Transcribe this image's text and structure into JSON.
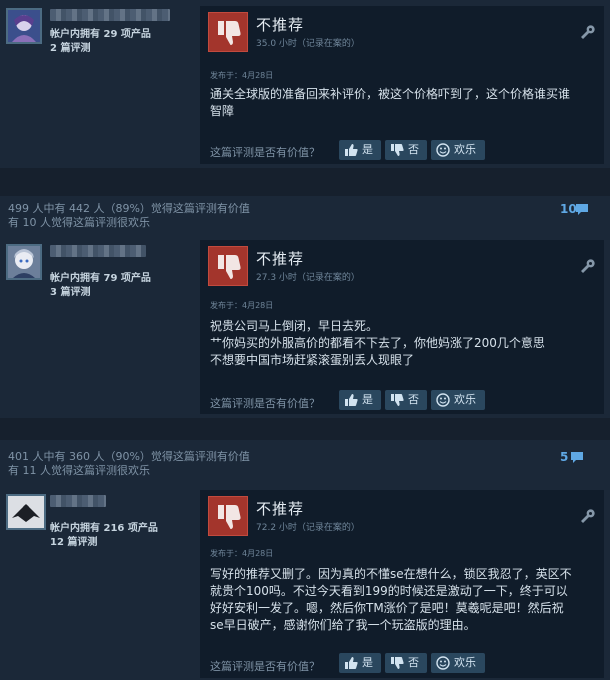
{
  "reviews": [
    {
      "owns": "帐户内拥有 29 项产品",
      "review_count": "2 篇评测",
      "recommendation": "不推荐",
      "hours": "35.0 小时（记录在案的）",
      "posted": "发布于：4月28日",
      "text_lines": [
        "通关全球版的准备回来补评价，被这个价格吓到了，这个价格谁买谁",
        "智障"
      ]
    },
    {
      "helpful_stats": [
        "499 人中有 442 人（89%）觉得这篇评测有价值",
        "有 10 人觉得这篇评测很欢乐"
      ],
      "comment_count": "10",
      "owns": "帐户内拥有 79 项产品",
      "review_count": "3 篇评测",
      "recommendation": "不推荐",
      "hours": "27.3 小时（记录在案的）",
      "posted": "发布于：4月28日",
      "text_lines": [
        "祝贵公司马上倒闭，早日去死。",
        "艹你妈买的外服高价的都看不下去了，你他妈涨了200几个意思",
        "不想要中国市场赶紧滚蛋别丢人现眼了"
      ]
    },
    {
      "helpful_stats": [
        "401 人中有 360 人（90%）觉得这篇评测有价值",
        "有 11 人觉得这篇评测很欢乐"
      ],
      "comment_count": "5",
      "owns": "帐户内拥有 216 项产品",
      "review_count": "12 篇评测",
      "recommendation": "不推荐",
      "hours": "72.2 小时（记录在案的）",
      "posted": "发布于：4月28日",
      "text_lines": [
        "写好的推荐又删了。因为真的不懂se在想什么，锁区我忍了，英区不",
        "就贵个100吗。不过今天看到199的时候还是激动了一下，终于可以",
        "好好安利一发了。嗯，然后你TM涨价了是吧！莫羲呢是吧！然后祝",
        "se早日破产，感谢你们给了我一个玩盗版的理由。"
      ]
    }
  ],
  "helpful_prompt": "这篇评测是否有价值？",
  "buttons": {
    "yes": "是",
    "no": "否",
    "funny": "欢乐"
  },
  "icons": {
    "thumbs_down": "thumbs-down-icon",
    "wrench": "wrench-icon",
    "thumbs_up": "thumbs-up-icon",
    "smile": "smile-icon",
    "comment": "comment-bubble-icon"
  },
  "colors": {
    "background": "#1b2838",
    "review_bg": "#101c2a",
    "thumb_down": "#a3352c",
    "button": "#2a475e",
    "comment_link": "#5fa8e4"
  }
}
